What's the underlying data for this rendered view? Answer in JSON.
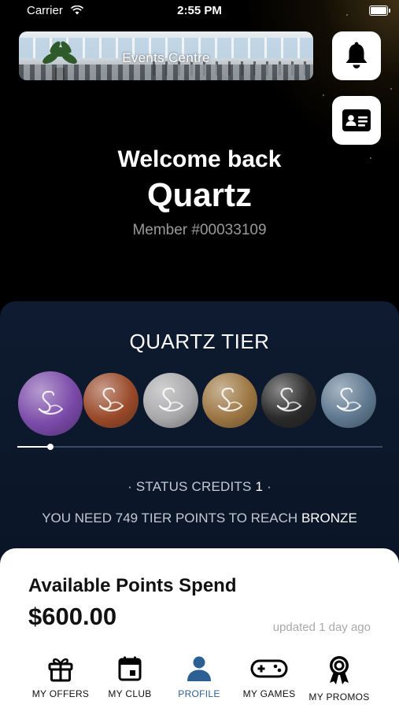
{
  "status_bar": {
    "carrier": "Carrier",
    "time": "2:55 PM"
  },
  "header": {
    "events_banner_label": "Events Centre",
    "bell_icon": "bell-icon",
    "member_card_icon": "id-card-icon"
  },
  "welcome": {
    "greeting": "Welcome back",
    "name": "Quartz",
    "member_number": "Member #00033109"
  },
  "tier": {
    "title": "QUARTZ TIER",
    "badges": [
      {
        "name": "quartz",
        "color": "#7a4aa8"
      },
      {
        "name": "bronze",
        "color": "#9a4a2a"
      },
      {
        "name": "silver",
        "color": "#a9a9ab"
      },
      {
        "name": "gold",
        "color": "#9c7642"
      },
      {
        "name": "black",
        "color": "#2a2a2a"
      },
      {
        "name": "platinum",
        "color": "#5f7990"
      }
    ],
    "progress_fraction": 0.09,
    "status_credits_label": "· STATUS CREDITS",
    "status_credits_value": "1",
    "status_credits_suffix": "·",
    "need_text": "YOU NEED 749 TIER POINTS TO REACH",
    "next_tier": "BRONZE"
  },
  "points": {
    "title": "Available Points Spend",
    "amount": "$600.00",
    "updated": "updated 1 day ago"
  },
  "tab_bar": {
    "active_color": "#2c5f94",
    "tabs": [
      {
        "label": "MY OFFERS",
        "icon": "gift-icon"
      },
      {
        "label": "MY CLUB",
        "icon": "calendar-icon"
      },
      {
        "label": "PROFILE",
        "icon": "person-icon"
      },
      {
        "label": "MY GAMES",
        "icon": "gamepad-icon"
      },
      {
        "label": "MY PROMOS",
        "icon": "award-icon"
      }
    ]
  }
}
